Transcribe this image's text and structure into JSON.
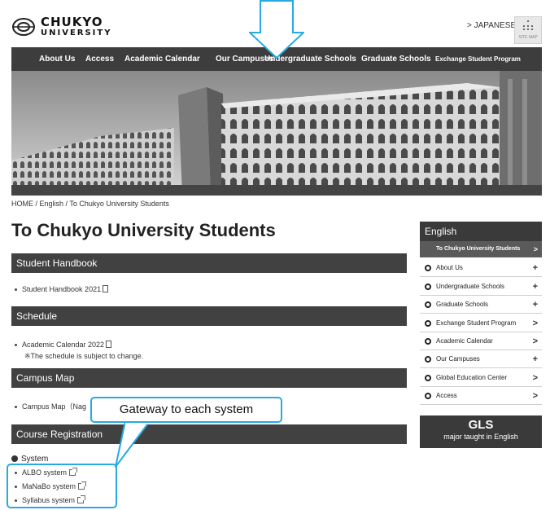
{
  "header": {
    "logo_line1": "CHUKYO",
    "logo_line2": "UNIVERSITY",
    "lang_link": "> JAPANESE",
    "sitemap_label": "SITE MAP"
  },
  "nav": {
    "items": [
      "About Us",
      "Access",
      "Academic Calendar",
      "Our Campuses",
      "Undergraduate Schools",
      "Graduate Schools",
      "Exchange Student Program"
    ]
  },
  "breadcrumb": "HOME / English / To Chukyo University Students",
  "page_title": "To Chukyo University Students",
  "sections": {
    "handbook": {
      "title": "Student Handbook",
      "item": "Student Handbook 2021"
    },
    "schedule": {
      "title": "Schedule",
      "item": "Academic Calendar 2022",
      "note": "※The schedule is subject to change."
    },
    "campus": {
      "title": "Campus Map",
      "item": "Campus Map（Nag"
    },
    "course": {
      "title": "Course Registration",
      "system_heading": "System"
    }
  },
  "systems": [
    "ALBO system",
    "MaNaBo system",
    "Syllabus system"
  ],
  "sidebar": {
    "title": "English",
    "current": "To Chukyo University Students",
    "current_marker": ">",
    "items": [
      {
        "label": "About Us",
        "marker": "+"
      },
      {
        "label": "Undergraduate Schools",
        "marker": "+"
      },
      {
        "label": "Graduate Schools",
        "marker": "+"
      },
      {
        "label": "Exchange Student Program",
        "marker": ">"
      },
      {
        "label": "Academic Calendar",
        "marker": ">"
      },
      {
        "label": "Our Campuses",
        "marker": "+"
      },
      {
        "label": "Global Education Center",
        "marker": ">"
      },
      {
        "label": "Access",
        "marker": ">"
      }
    ],
    "gls_title": "GLS",
    "gls_sub": "major taught in English"
  },
  "annotation": {
    "callout_text": "Gateway to each system",
    "accent_color": "#27aae1"
  }
}
